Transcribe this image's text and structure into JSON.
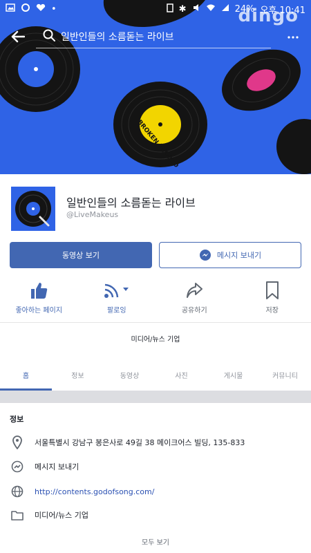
{
  "status_bar": {
    "battery": "24%",
    "time": "오후 10:41"
  },
  "watermark": "dingo",
  "header": {
    "search_text": "일반인들의 소름돋는 라이브"
  },
  "record_labels": [
    "BROKEN RECORD"
  ],
  "page": {
    "name": "일반인들의 소름돋는 라이브",
    "handle": "@LiveMakeus",
    "category": "미디어/뉴스 기업"
  },
  "buttons": {
    "watch_video": "동영상 보기",
    "send_message": "메시지 보내기"
  },
  "actions": [
    {
      "label": "좋아하는 페이지",
      "icon": "thumbs-up-icon",
      "active": true
    },
    {
      "label": "팔로잉",
      "icon": "follow-feed-icon",
      "active": true
    },
    {
      "label": "공유하기",
      "icon": "share-icon",
      "active": false
    },
    {
      "label": "저장",
      "icon": "bookmark-icon",
      "active": false
    }
  ],
  "tabs": [
    {
      "label": "홈",
      "active": true
    },
    {
      "label": "정보",
      "active": false
    },
    {
      "label": "동영상",
      "active": false
    },
    {
      "label": "사진",
      "active": false
    },
    {
      "label": "게시물",
      "active": false
    },
    {
      "label": "커뮤니티",
      "active": false
    }
  ],
  "info": {
    "title": "정보",
    "address": "서울특별시 강남구 봉은사로 49길 38 메이크어스 빌딩, 135-833",
    "message": "메시지 보내기",
    "website": "http://contents.godofsong.com/",
    "category": "미디어/뉴스 기업",
    "see_all": "모두 보기"
  },
  "colors": {
    "cover_blue": "#2f63e6",
    "brand_blue": "#4267b2",
    "band_gray": "#dcdde1"
  }
}
